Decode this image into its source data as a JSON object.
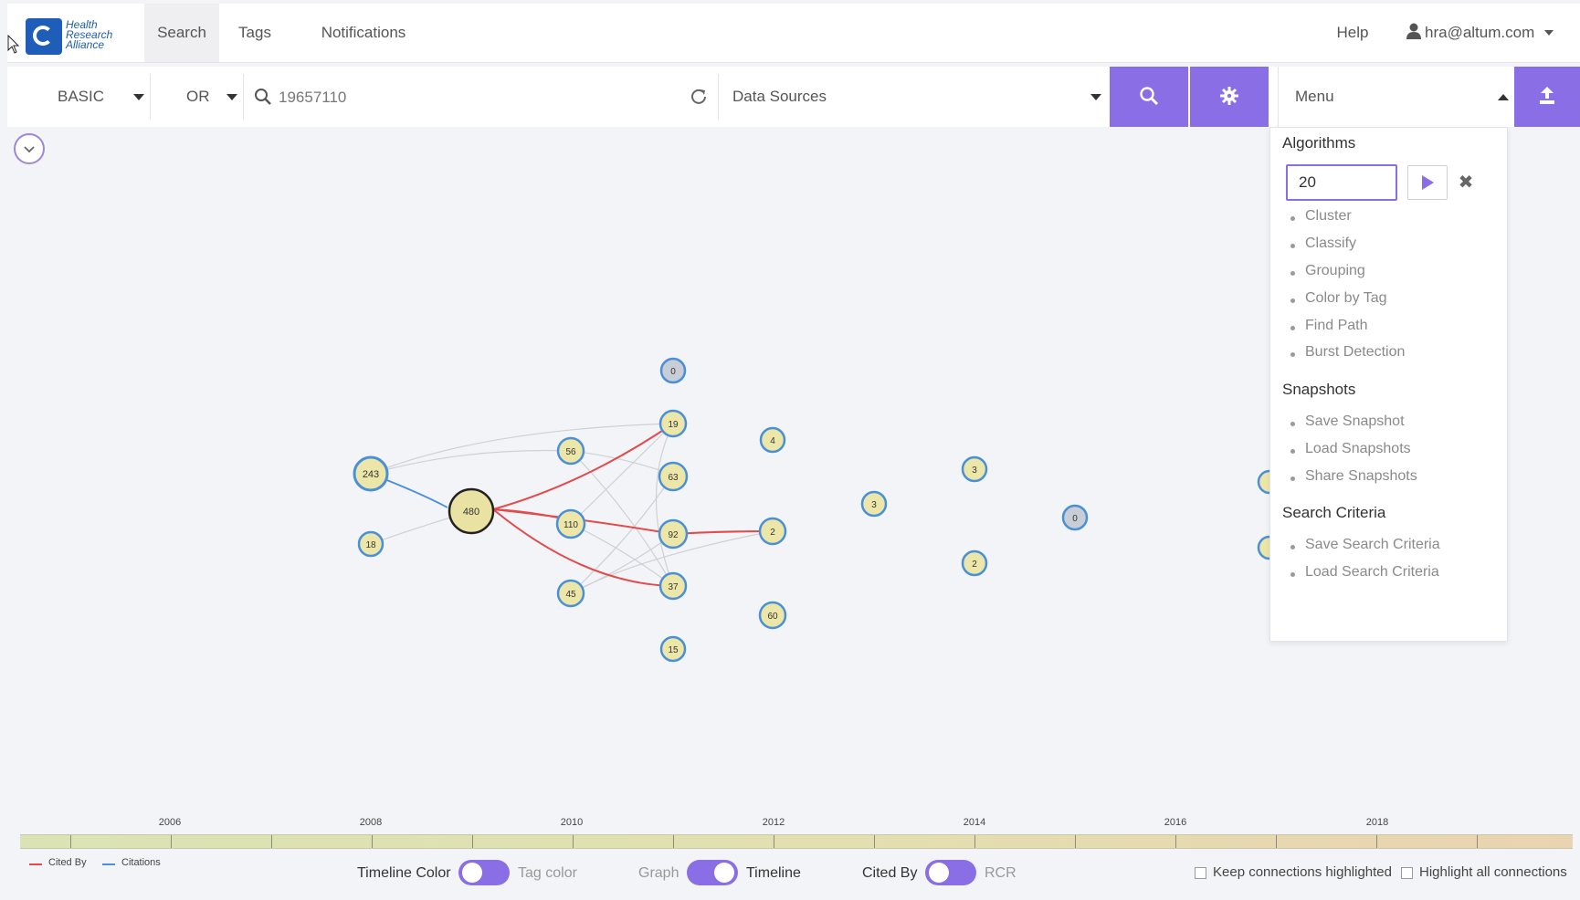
{
  "nav": {
    "logo_text": "Health Research Alliance",
    "tabs": [
      "Search",
      "Tags",
      "Notifications"
    ],
    "help": "Help",
    "user": "hra@altum.com"
  },
  "searchbar": {
    "mode": "BASIC",
    "operator": "OR",
    "query": "19657110",
    "data_sources": "Data Sources",
    "menu": "Menu"
  },
  "menu_panel": {
    "algorithms_title": "Algorithms",
    "input_value": "20",
    "algorithms": [
      "Cluster",
      "Classify",
      "Grouping",
      "Color by Tag",
      "Find Path",
      "Burst Detection"
    ],
    "snapshots_title": "Snapshots",
    "snapshots": [
      "Save Snapshot",
      "Load Snapshots",
      "Share Snapshots"
    ],
    "criteria_title": "Search Criteria",
    "criteria": [
      "Save Search Criteria",
      "Load Search Criteria"
    ]
  },
  "graph": {
    "nodes": [
      "480",
      "243",
      "18",
      "56",
      "110",
      "45",
      "0",
      "19",
      "63",
      "92",
      "37",
      "15",
      "4",
      "2",
      "60",
      "3",
      "3",
      "2",
      "0"
    ]
  },
  "timeline": {
    "years": [
      "2006",
      "2008",
      "2010",
      "2012",
      "2014",
      "2016",
      "2018"
    ]
  },
  "legend": {
    "cited_by": "Cited By",
    "citations": "Citations",
    "cited_by_color": "#e24b4b",
    "citations_color": "#4a90d9"
  },
  "controls": {
    "timeline_color": "Timeline Color",
    "tag_color": "Tag color",
    "graph": "Graph",
    "timeline": "Timeline",
    "cited_by": "Cited By",
    "rcr": "RCR",
    "keep_highlighted": "Keep connections highlighted",
    "highlight_all": "Highlight all connections"
  },
  "colors": {
    "accent": "#8a6ee6",
    "node_fill": "#ece6a8",
    "node_ring": "#4a90d9"
  }
}
